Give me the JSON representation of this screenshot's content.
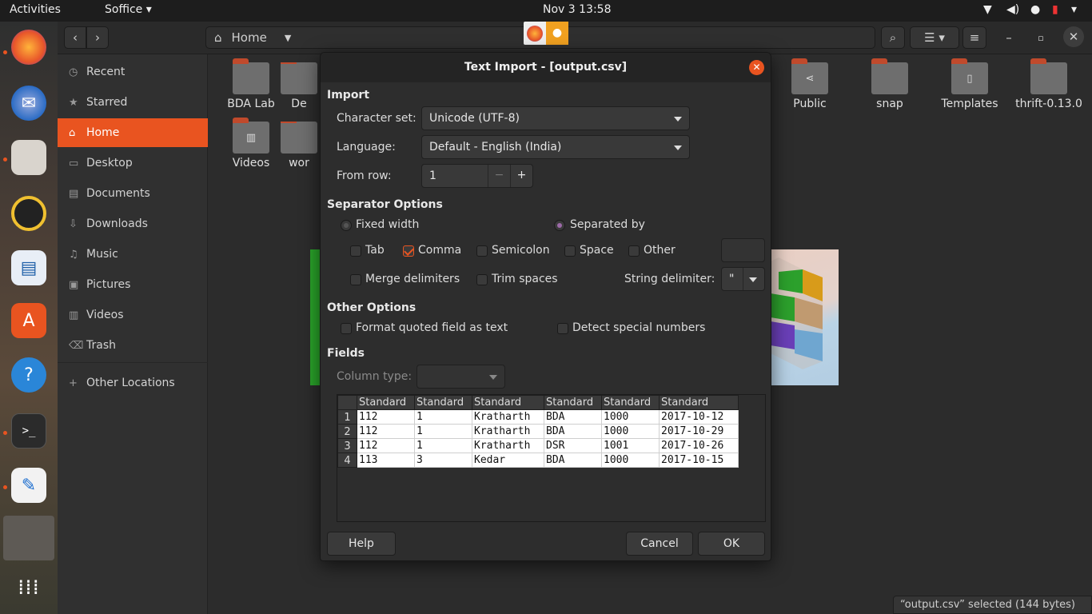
{
  "topbar": {
    "activities": "Activities",
    "app_menu": "Soffice",
    "clock": "Nov 3  13:58"
  },
  "files": {
    "location": "Home",
    "sidebar": [
      {
        "label": "Recent",
        "icon": "clock-icon"
      },
      {
        "label": "Starred",
        "icon": "star-icon"
      },
      {
        "label": "Home",
        "icon": "home-icon"
      },
      {
        "label": "Desktop",
        "icon": "desktop-icon"
      },
      {
        "label": "Documents",
        "icon": "document-icon"
      },
      {
        "label": "Downloads",
        "icon": "download-icon"
      },
      {
        "label": "Music",
        "icon": "music-icon"
      },
      {
        "label": "Pictures",
        "icon": "picture-icon"
      },
      {
        "label": "Videos",
        "icon": "video-icon"
      },
      {
        "label": "Trash",
        "icon": "trash-icon"
      }
    ],
    "other_locations": "Other Locations",
    "folders": [
      "BDA Lab",
      "De",
      "Public",
      "snap",
      "Templates",
      "thrift-0.13.0",
      "Videos",
      "wor"
    ],
    "status": "“output.csv” selected  (144 bytes)"
  },
  "dialog": {
    "title": "Text Import - [output.csv]",
    "import_heading": "Import",
    "charset_label": "Character set:",
    "charset_value": "Unicode (UTF-8)",
    "language_label": "Language:",
    "language_value": "Default - English (India)",
    "fromrow_label": "From row:",
    "fromrow_value": "1",
    "sep_heading": "Separator Options",
    "fixed_width": "Fixed width",
    "separated_by": "Separated by",
    "tab": "Tab",
    "comma": "Comma",
    "semicolon": "Semicolon",
    "space": "Space",
    "other": "Other",
    "merge": "Merge delimiters",
    "trim": "Trim spaces",
    "string_delim_label": "String delimiter:",
    "string_delim_value": "\"",
    "other_heading": "Other Options",
    "format_quoted": "Format quoted field as text",
    "detect_special": "Detect special numbers",
    "fields_heading": "Fields",
    "column_type_label": "Column type:",
    "column_headers": [
      "Standard",
      "Standard",
      "Standard",
      "Standard",
      "Standard",
      "Standard"
    ],
    "rows": [
      {
        "n": "1",
        "cells": [
          "112",
          "1",
          "Kratharth",
          "BDA",
          "1000",
          "2017-10-12"
        ]
      },
      {
        "n": "2",
        "cells": [
          "112",
          "1",
          "Kratharth",
          "BDA",
          "1000",
          "2017-10-29"
        ]
      },
      {
        "n": "3",
        "cells": [
          "112",
          "1",
          "Kratharth",
          "DSR",
          "1001",
          "2017-10-26"
        ]
      },
      {
        "n": "4",
        "cells": [
          "113",
          "3",
          "Kedar",
          "BDA",
          "1000",
          "2017-10-15"
        ]
      }
    ],
    "help": "Help",
    "cancel": "Cancel",
    "ok": "OK"
  }
}
